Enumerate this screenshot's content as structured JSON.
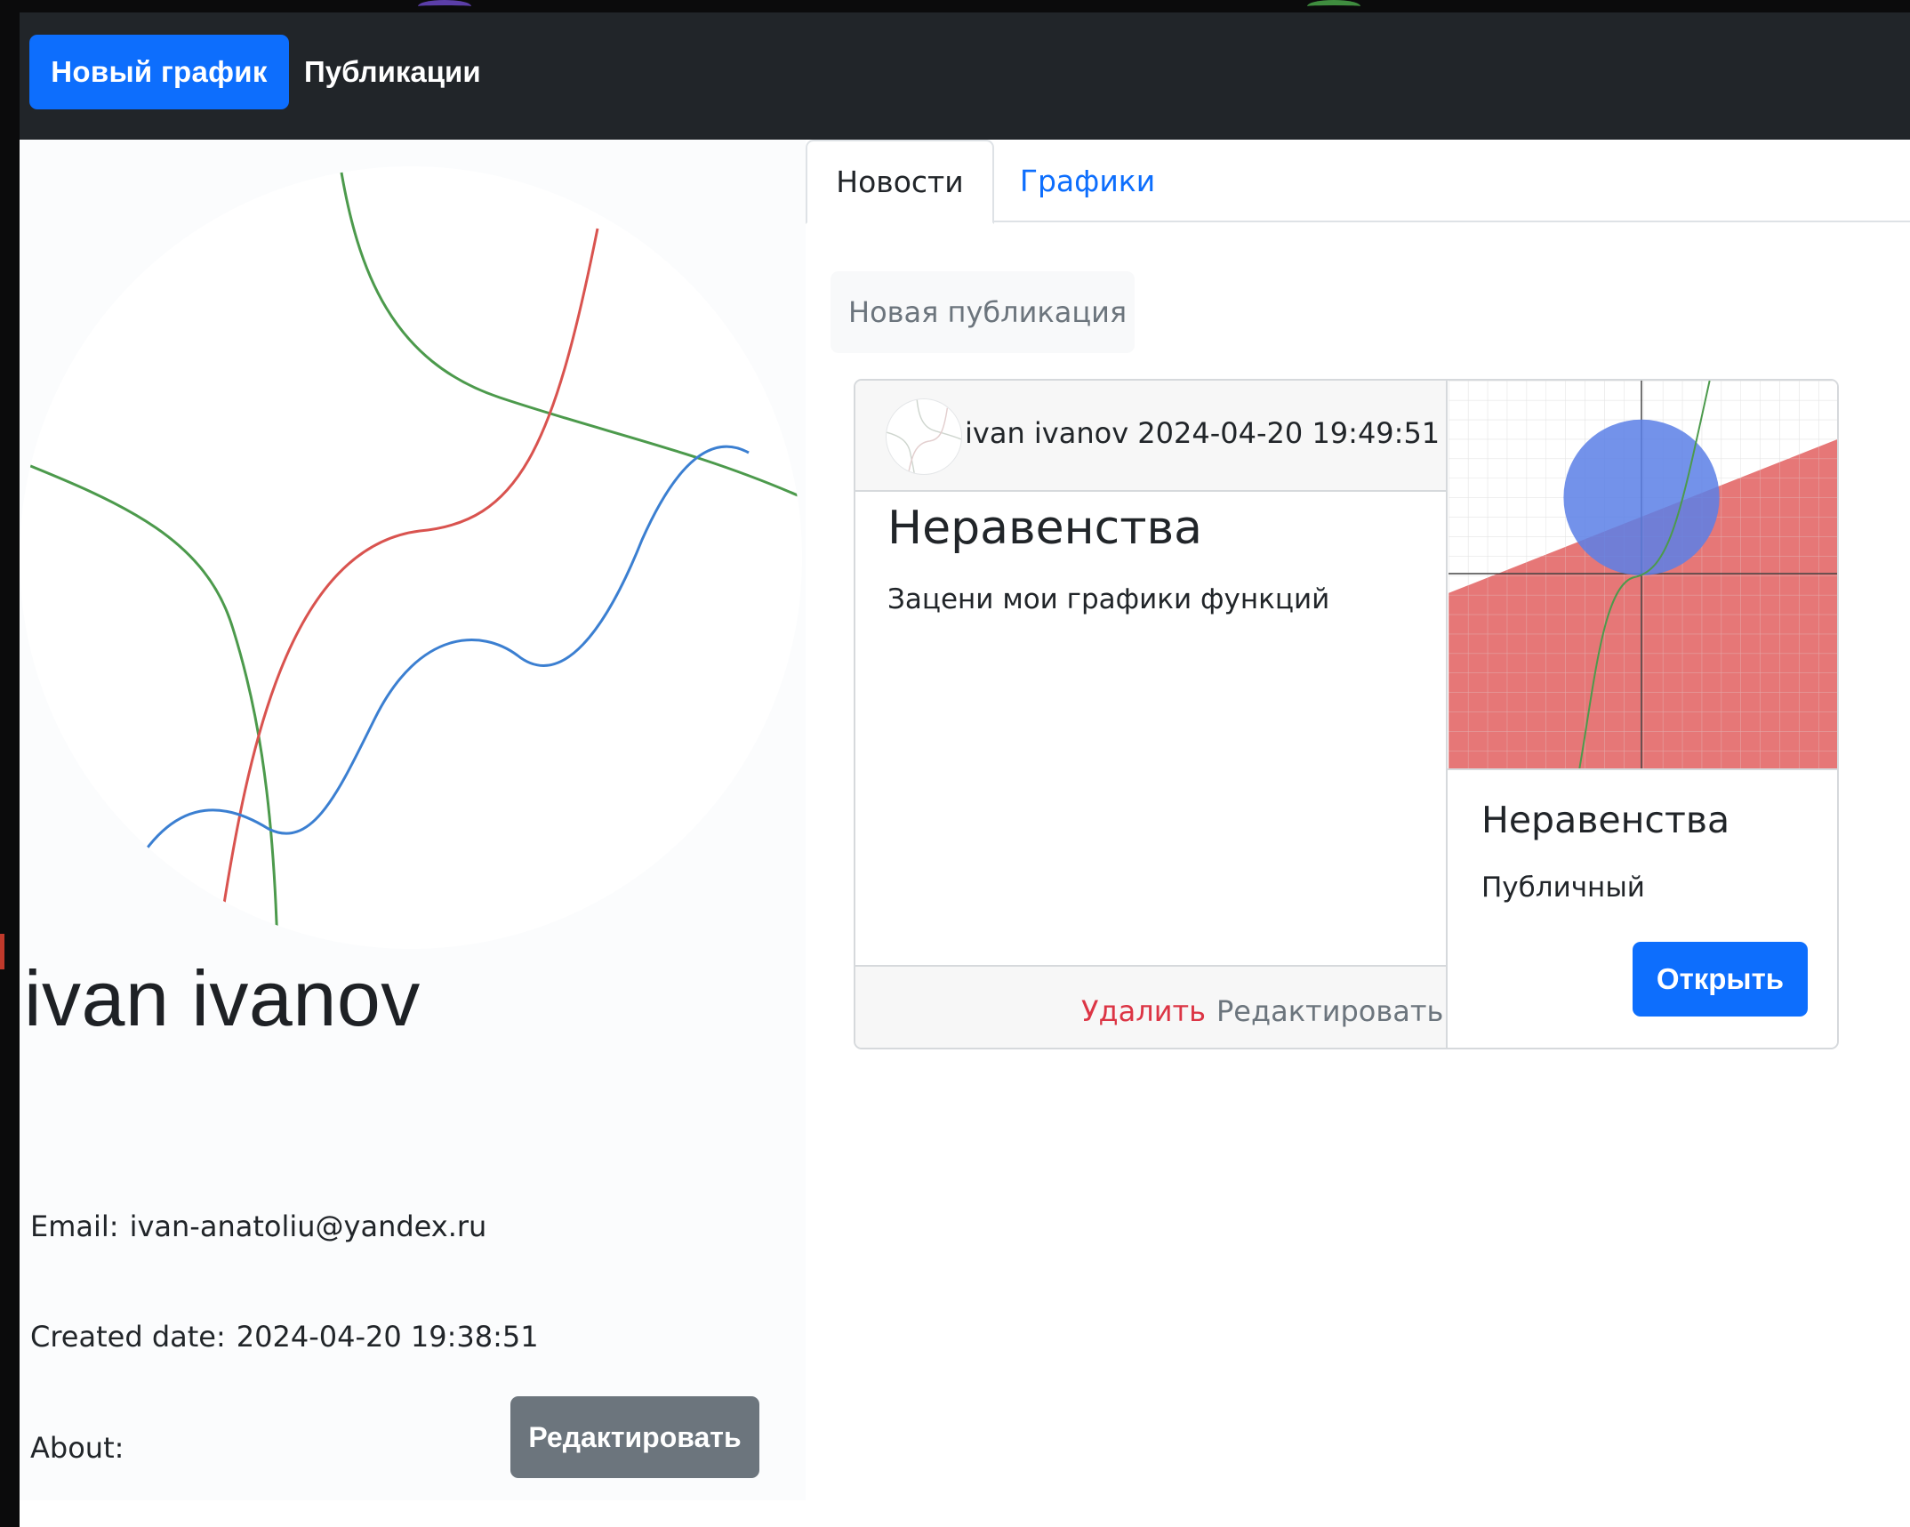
{
  "colors": {
    "navbar_bg": "#212529",
    "primary": "#0d6efd",
    "secondary": "#6c757d",
    "danger": "#dc3545",
    "graph_red": "#e46b6b",
    "graph_blue": "#5b7fe6",
    "graph_green": "#4c9a4c"
  },
  "navbar": {
    "new_graph_label": "Новый график",
    "publications_label": "Публикации"
  },
  "profile": {
    "avatar_icon": "function-graph-avatar",
    "name": "ivan ivanov",
    "email_label": "Email:",
    "email_value": "ivan-anatoliu@yandex.ru",
    "created_label": "Created date:",
    "created_value": "2024-04-20 19:38:51",
    "about_label": "About:",
    "about_value": "",
    "edit_label": "Редактировать"
  },
  "tabs": [
    {
      "label": "Новости",
      "active": true
    },
    {
      "label": "Графики",
      "active": false
    }
  ],
  "feed": {
    "new_publication_label": "Новая публикация",
    "post": {
      "author_line": "ivan ivanov 2024-04-20 19:49:51",
      "title": "Неравенства",
      "text": "Зацени мои графики функций",
      "delete_label": "Удалить",
      "edit_label": "Редактировать",
      "graph": {
        "title": "Неравенства",
        "visibility": "Публичный",
        "open_label": "Открыть",
        "thumbnail_icon": "inequality-graph-thumbnail"
      }
    }
  }
}
